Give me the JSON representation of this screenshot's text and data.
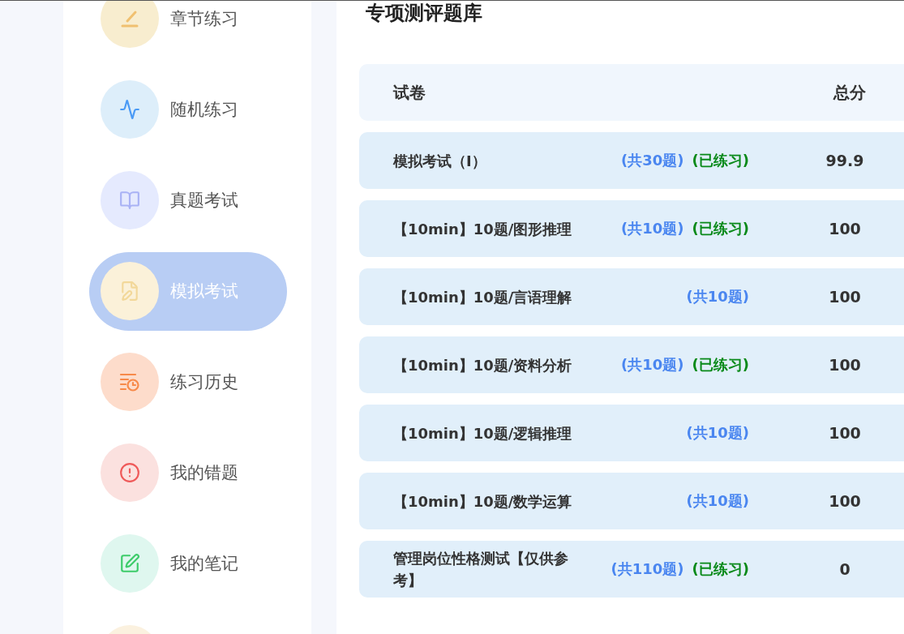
{
  "sidebar": {
    "items": [
      {
        "label": "章节练习",
        "selected": false
      },
      {
        "label": "随机练习",
        "selected": false
      },
      {
        "label": "真题考试",
        "selected": false
      },
      {
        "label": "模拟考试",
        "selected": true
      },
      {
        "label": "练习历史",
        "selected": false
      },
      {
        "label": "我的错题",
        "selected": false
      },
      {
        "label": "我的笔记",
        "selected": false
      },
      {
        "selected": false
      }
    ]
  },
  "main": {
    "title": "专项测评题库",
    "table": {
      "columns": [
        "试卷",
        "总分"
      ],
      "rows": [
        {
          "name": "模拟考试（I）",
          "count": "(共30题)",
          "practiced": "(已练习)",
          "score": "99.9"
        },
        {
          "name": "【10min】10题/图形推理",
          "count": "(共10题)",
          "practiced": "(已练习)",
          "score": "100"
        },
        {
          "name": "【10min】10题/言语理解",
          "count": "(共10题)",
          "score": "100"
        },
        {
          "name": "【10min】10题/资料分析",
          "count": "(共10题)",
          "practiced": "(已练习)",
          "score": "100"
        },
        {
          "name": "【10min】10题/逻辑推理",
          "count": "(共10题)",
          "score": "100"
        },
        {
          "name": "【10min】10题/数学运算",
          "count": "(共10题)",
          "score": "100"
        },
        {
          "name": "管理岗位性格测试【仅供参考】",
          "count": "(共110题)",
          "practiced": "(已练习)",
          "score": "0"
        }
      ]
    }
  }
}
